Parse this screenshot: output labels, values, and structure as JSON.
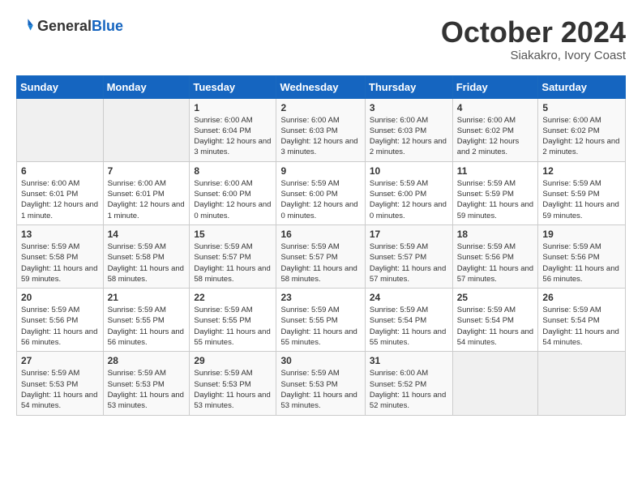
{
  "header": {
    "logo_general": "General",
    "logo_blue": "Blue",
    "month_year": "October 2024",
    "location": "Siakakro, Ivory Coast"
  },
  "calendar": {
    "days_of_week": [
      "Sunday",
      "Monday",
      "Tuesday",
      "Wednesday",
      "Thursday",
      "Friday",
      "Saturday"
    ],
    "weeks": [
      [
        {
          "day": "",
          "empty": true
        },
        {
          "day": "",
          "empty": true
        },
        {
          "day": "1",
          "sunrise": "Sunrise: 6:00 AM",
          "sunset": "Sunset: 6:04 PM",
          "daylight": "Daylight: 12 hours and 3 minutes."
        },
        {
          "day": "2",
          "sunrise": "Sunrise: 6:00 AM",
          "sunset": "Sunset: 6:03 PM",
          "daylight": "Daylight: 12 hours and 3 minutes."
        },
        {
          "day": "3",
          "sunrise": "Sunrise: 6:00 AM",
          "sunset": "Sunset: 6:03 PM",
          "daylight": "Daylight: 12 hours and 2 minutes."
        },
        {
          "day": "4",
          "sunrise": "Sunrise: 6:00 AM",
          "sunset": "Sunset: 6:02 PM",
          "daylight": "Daylight: 12 hours and 2 minutes."
        },
        {
          "day": "5",
          "sunrise": "Sunrise: 6:00 AM",
          "sunset": "Sunset: 6:02 PM",
          "daylight": "Daylight: 12 hours and 2 minutes."
        }
      ],
      [
        {
          "day": "6",
          "sunrise": "Sunrise: 6:00 AM",
          "sunset": "Sunset: 6:01 PM",
          "daylight": "Daylight: 12 hours and 1 minute."
        },
        {
          "day": "7",
          "sunrise": "Sunrise: 6:00 AM",
          "sunset": "Sunset: 6:01 PM",
          "daylight": "Daylight: 12 hours and 1 minute."
        },
        {
          "day": "8",
          "sunrise": "Sunrise: 6:00 AM",
          "sunset": "Sunset: 6:00 PM",
          "daylight": "Daylight: 12 hours and 0 minutes."
        },
        {
          "day": "9",
          "sunrise": "Sunrise: 5:59 AM",
          "sunset": "Sunset: 6:00 PM",
          "daylight": "Daylight: 12 hours and 0 minutes."
        },
        {
          "day": "10",
          "sunrise": "Sunrise: 5:59 AM",
          "sunset": "Sunset: 6:00 PM",
          "daylight": "Daylight: 12 hours and 0 minutes."
        },
        {
          "day": "11",
          "sunrise": "Sunrise: 5:59 AM",
          "sunset": "Sunset: 5:59 PM",
          "daylight": "Daylight: 11 hours and 59 minutes."
        },
        {
          "day": "12",
          "sunrise": "Sunrise: 5:59 AM",
          "sunset": "Sunset: 5:59 PM",
          "daylight": "Daylight: 11 hours and 59 minutes."
        }
      ],
      [
        {
          "day": "13",
          "sunrise": "Sunrise: 5:59 AM",
          "sunset": "Sunset: 5:58 PM",
          "daylight": "Daylight: 11 hours and 59 minutes."
        },
        {
          "day": "14",
          "sunrise": "Sunrise: 5:59 AM",
          "sunset": "Sunset: 5:58 PM",
          "daylight": "Daylight: 11 hours and 58 minutes."
        },
        {
          "day": "15",
          "sunrise": "Sunrise: 5:59 AM",
          "sunset": "Sunset: 5:57 PM",
          "daylight": "Daylight: 11 hours and 58 minutes."
        },
        {
          "day": "16",
          "sunrise": "Sunrise: 5:59 AM",
          "sunset": "Sunset: 5:57 PM",
          "daylight": "Daylight: 11 hours and 58 minutes."
        },
        {
          "day": "17",
          "sunrise": "Sunrise: 5:59 AM",
          "sunset": "Sunset: 5:57 PM",
          "daylight": "Daylight: 11 hours and 57 minutes."
        },
        {
          "day": "18",
          "sunrise": "Sunrise: 5:59 AM",
          "sunset": "Sunset: 5:56 PM",
          "daylight": "Daylight: 11 hours and 57 minutes."
        },
        {
          "day": "19",
          "sunrise": "Sunrise: 5:59 AM",
          "sunset": "Sunset: 5:56 PM",
          "daylight": "Daylight: 11 hours and 56 minutes."
        }
      ],
      [
        {
          "day": "20",
          "sunrise": "Sunrise: 5:59 AM",
          "sunset": "Sunset: 5:56 PM",
          "daylight": "Daylight: 11 hours and 56 minutes."
        },
        {
          "day": "21",
          "sunrise": "Sunrise: 5:59 AM",
          "sunset": "Sunset: 5:55 PM",
          "daylight": "Daylight: 11 hours and 56 minutes."
        },
        {
          "day": "22",
          "sunrise": "Sunrise: 5:59 AM",
          "sunset": "Sunset: 5:55 PM",
          "daylight": "Daylight: 11 hours and 55 minutes."
        },
        {
          "day": "23",
          "sunrise": "Sunrise: 5:59 AM",
          "sunset": "Sunset: 5:55 PM",
          "daylight": "Daylight: 11 hours and 55 minutes."
        },
        {
          "day": "24",
          "sunrise": "Sunrise: 5:59 AM",
          "sunset": "Sunset: 5:54 PM",
          "daylight": "Daylight: 11 hours and 55 minutes."
        },
        {
          "day": "25",
          "sunrise": "Sunrise: 5:59 AM",
          "sunset": "Sunset: 5:54 PM",
          "daylight": "Daylight: 11 hours and 54 minutes."
        },
        {
          "day": "26",
          "sunrise": "Sunrise: 5:59 AM",
          "sunset": "Sunset: 5:54 PM",
          "daylight": "Daylight: 11 hours and 54 minutes."
        }
      ],
      [
        {
          "day": "27",
          "sunrise": "Sunrise: 5:59 AM",
          "sunset": "Sunset: 5:53 PM",
          "daylight": "Daylight: 11 hours and 54 minutes."
        },
        {
          "day": "28",
          "sunrise": "Sunrise: 5:59 AM",
          "sunset": "Sunset: 5:53 PM",
          "daylight": "Daylight: 11 hours and 53 minutes."
        },
        {
          "day": "29",
          "sunrise": "Sunrise: 5:59 AM",
          "sunset": "Sunset: 5:53 PM",
          "daylight": "Daylight: 11 hours and 53 minutes."
        },
        {
          "day": "30",
          "sunrise": "Sunrise: 5:59 AM",
          "sunset": "Sunset: 5:53 PM",
          "daylight": "Daylight: 11 hours and 53 minutes."
        },
        {
          "day": "31",
          "sunrise": "Sunrise: 6:00 AM",
          "sunset": "Sunset: 5:52 PM",
          "daylight": "Daylight: 11 hours and 52 minutes."
        },
        {
          "day": "",
          "empty": true
        },
        {
          "day": "",
          "empty": true
        }
      ]
    ]
  }
}
